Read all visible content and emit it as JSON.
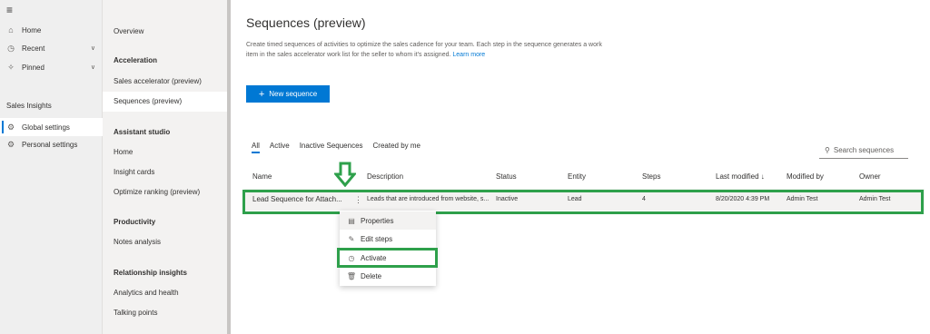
{
  "leftnav": {
    "items": [
      {
        "label": "Home",
        "icon": "home-icon"
      },
      {
        "label": "Recent",
        "icon": "clock-icon"
      },
      {
        "label": "Pinned",
        "icon": "pin-icon"
      }
    ],
    "group_title": "Sales Insights",
    "group_items": [
      {
        "label": "Global settings",
        "icon": "settings-icon"
      },
      {
        "label": "Personal settings",
        "icon": "person-settings-icon"
      }
    ]
  },
  "subnav": {
    "overview": "Overview",
    "sections": [
      {
        "title": "Acceleration",
        "items": [
          "Sales accelerator (preview)",
          "Sequences (preview)"
        ]
      },
      {
        "title": "Assistant studio",
        "items": [
          "Home",
          "Insight cards",
          "Optimize ranking (preview)"
        ]
      },
      {
        "title": "Productivity",
        "items": [
          "Notes analysis"
        ]
      },
      {
        "title": "Relationship insights",
        "items": [
          "Analytics and health",
          "Talking points"
        ]
      }
    ]
  },
  "main": {
    "title": "Sequences (preview)",
    "description": "Create timed sequences of activities to optimize the sales cadence for your team. Each step in the sequence generates a work item in the sales accelerator work list for the seller to whom it's assigned.",
    "learn_more": "Learn more",
    "new_button": "New sequence",
    "tabs": [
      "All",
      "Active",
      "Inactive Sequences",
      "Created by me"
    ],
    "search_placeholder": "Search sequences",
    "columns": [
      "Name",
      "Description",
      "Status",
      "Entity",
      "Steps",
      "Last modified ↓",
      "Modified by",
      "Owner"
    ],
    "rows": [
      {
        "name": "Lead Sequence for Attach...",
        "description": "Leads that are introduced from website, s...",
        "status": "Inactive",
        "entity": "Lead",
        "steps": "4",
        "last_modified": "8/20/2020 4:39 PM",
        "modified_by": "Admin Test",
        "owner": "Admin Test"
      }
    ],
    "context_menu": [
      {
        "label": "Properties",
        "icon": "properties-icon"
      },
      {
        "label": "Edit steps",
        "icon": "edit-icon"
      },
      {
        "label": "Activate",
        "icon": "activate-icon"
      },
      {
        "label": "Delete",
        "icon": "delete-icon"
      }
    ]
  },
  "colors": {
    "accent": "#0078d4",
    "highlight": "#2ea04b"
  }
}
